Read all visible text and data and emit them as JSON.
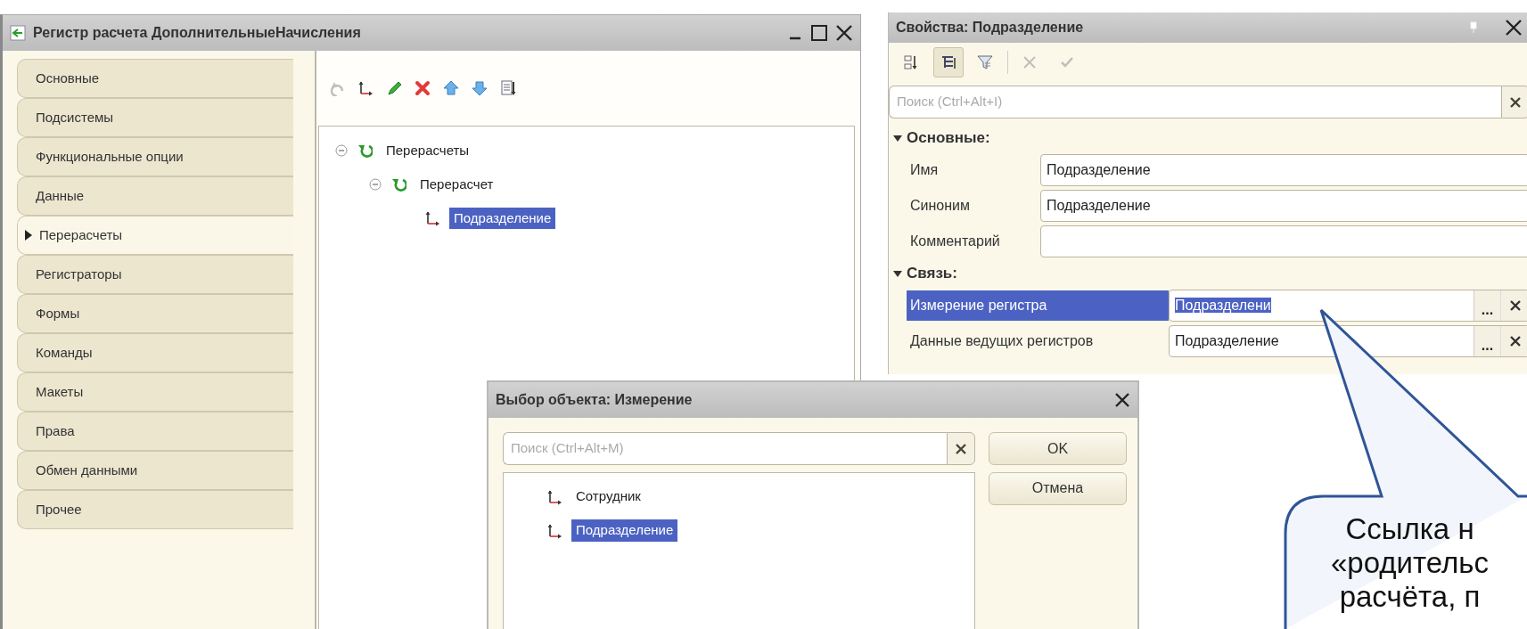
{
  "main_window": {
    "title": "Регистр расчета ДополнительныеНачисления",
    "tabs": [
      {
        "label": "Основные",
        "selected": false
      },
      {
        "label": "Подсистемы",
        "selected": false
      },
      {
        "label": "Функциональные опции",
        "selected": false
      },
      {
        "label": "Данные",
        "selected": false
      },
      {
        "label": "Перерасчеты",
        "selected": true
      },
      {
        "label": "Регистраторы",
        "selected": false
      },
      {
        "label": "Формы",
        "selected": false
      },
      {
        "label": "Команды",
        "selected": false
      },
      {
        "label": "Макеты",
        "selected": false
      },
      {
        "label": "Права",
        "selected": false
      },
      {
        "label": "Обмен данными",
        "selected": false
      },
      {
        "label": "Прочее",
        "selected": false
      }
    ],
    "toolbar": [
      {
        "kind": "undo",
        "disabled": true
      },
      {
        "kind": "dimension",
        "disabled": false
      },
      {
        "kind": "edit",
        "disabled": false
      },
      {
        "kind": "delete",
        "disabled": false
      },
      {
        "kind": "up",
        "disabled": false
      },
      {
        "kind": "down",
        "disabled": false
      },
      {
        "kind": "list",
        "disabled": false
      }
    ],
    "tree": [
      {
        "label": "Перерасчеты",
        "kind": "recalc",
        "expanded": true,
        "selected": false,
        "children": [
          {
            "label": "Перерасчет",
            "kind": "recalc",
            "expanded": true,
            "selected": false,
            "children": [
              {
                "label": "Подразделение",
                "kind": "dimension",
                "selected": true
              }
            ]
          }
        ]
      }
    ]
  },
  "properties": {
    "title": "Свойства: Подразделение",
    "toolbar": [
      {
        "kind": "sort",
        "pressed": false,
        "disabled": false
      },
      {
        "kind": "categories",
        "pressed": true,
        "disabled": false
      },
      {
        "kind": "filter",
        "pressed": false,
        "disabled": false
      },
      {
        "kind": "cancel",
        "pressed": false,
        "disabled": true
      },
      {
        "kind": "confirm",
        "pressed": false,
        "disabled": true
      }
    ],
    "search": {
      "placeholder": "Поиск (Ctrl+Alt+I)"
    },
    "groups": [
      {
        "title": "Основные:",
        "expanded": true,
        "rows": [
          {
            "label": "Имя",
            "value": "Подразделение",
            "kind": "text",
            "selected": false
          },
          {
            "label": "Синоним",
            "value": "Подразделение",
            "kind": "text",
            "selected": false
          },
          {
            "label": "Комментарий",
            "kind": "text",
            "selected": false
          }
        ]
      },
      {
        "title": "Связь:",
        "expanded": true,
        "rows": [
          {
            "label": "Измерение регистра",
            "value": "Подразделени",
            "kind": "choice",
            "select": "...",
            "selected": true
          },
          {
            "label": "Данные ведущих регистров",
            "value": "Подразделение",
            "kind": "choice",
            "select": "...",
            "selected": false
          }
        ]
      }
    ]
  },
  "dialog": {
    "title": "Выбор объекта: Измерение",
    "search": {
      "placeholder": "Поиск (Ctrl+Alt+M)"
    },
    "items": [
      {
        "label": "Сотрудник",
        "selected": false
      },
      {
        "label": "Подразделение",
        "selected": true
      }
    ],
    "buttons": [
      "OK",
      "Отмена"
    ]
  },
  "callout": {
    "lines": [
      "Ссылка н",
      "«родительс",
      "расчёта, п"
    ]
  }
}
